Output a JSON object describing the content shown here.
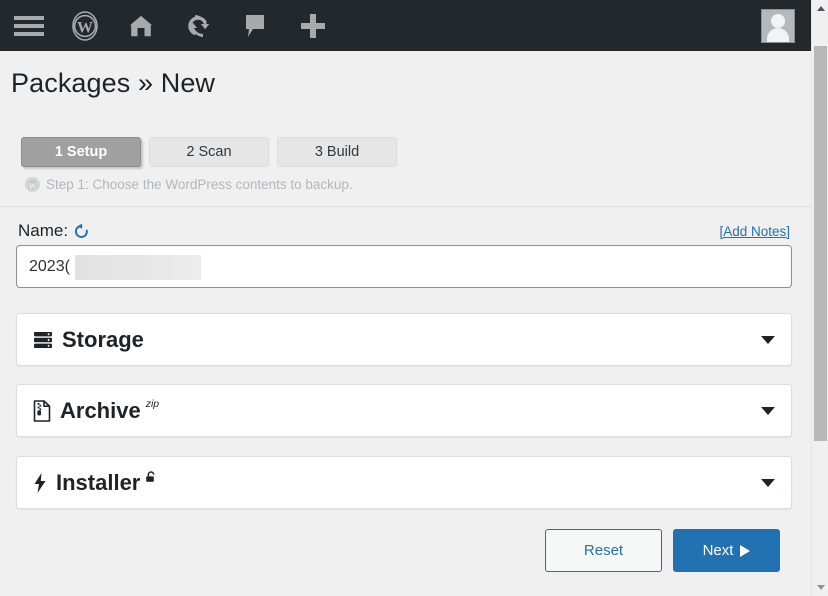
{
  "adminbar": {
    "items": [
      {
        "name": "menu-icon",
        "label": "Menu"
      },
      {
        "name": "wordpress-logo-icon",
        "label": "About WordPress"
      },
      {
        "name": "home-icon",
        "label": "Visit Site"
      },
      {
        "name": "updates-icon",
        "label": "Updates"
      },
      {
        "name": "comments-icon",
        "label": "Comments"
      },
      {
        "name": "new-content-icon",
        "label": "New"
      }
    ],
    "avatar_label": "My Account"
  },
  "page": {
    "title_main": "Packages",
    "title_separator": "»",
    "title_sub": "New"
  },
  "steps": [
    {
      "label": "1 Setup",
      "active": true
    },
    {
      "label": "2 Scan",
      "active": false
    },
    {
      "label": "3 Build",
      "active": false
    }
  ],
  "step_description": "Step 1: Choose the WordPress contents to backup.",
  "name_section": {
    "label": "Name:",
    "reset_icon": "reset-arrow-icon",
    "add_notes_link": "[Add Notes]",
    "input_value": "2023(",
    "input_placeholder": ""
  },
  "panels": [
    {
      "icon": "server-storage-icon",
      "title": "Storage",
      "superscript": "",
      "badge": "",
      "chevron": "chevron-down-icon"
    },
    {
      "icon": "file-zip-icon",
      "title": "Archive",
      "superscript": "zip",
      "badge": "",
      "chevron": "chevron-down-icon"
    },
    {
      "icon": "lightning-bolt-icon",
      "title": "Installer",
      "superscript": "",
      "badge": "unlock-icon",
      "chevron": "chevron-down-icon"
    }
  ],
  "footer": {
    "reset_label": "Reset",
    "next_label": "Next"
  },
  "colors": {
    "adminbar_bg": "#23282d",
    "page_bg": "#f0f0f1",
    "accent_blue": "#2271b1",
    "active_step_bg": "#a0a0a0",
    "panel_bg": "#ffffff"
  }
}
